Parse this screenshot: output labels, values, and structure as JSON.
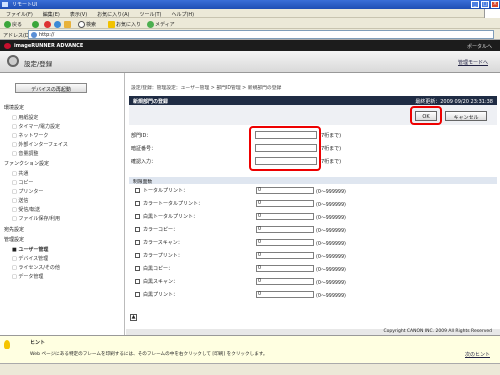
{
  "window": {
    "title": "リモートUI",
    "controls": [
      "_",
      "□",
      "×"
    ]
  },
  "menu": [
    "ファイル(F)",
    "編集(E)",
    "表示(V)",
    "お気に入り(A)",
    "ツール(T)",
    "ヘルプ(H)"
  ],
  "toolbar": {
    "back": "戻る",
    "search": "検索",
    "favorites": "お気に入り",
    "media": "メディア"
  },
  "address": {
    "label": "アドレス(D)",
    "value": "http://"
  },
  "header": {
    "brand": "imageRUNNER ADVANCE",
    "portal": "ポータルへ"
  },
  "page": {
    "title": "設定/登録",
    "link": "管理モードへ"
  },
  "sidebar": {
    "device_button": "デバイスの再起動",
    "groups": [
      {
        "label": "環境設定",
        "items": [
          "用紙設定",
          "タイマー/電力設定",
          "ネットワーク",
          "外部インターフェイス",
          "音量調整"
        ]
      },
      {
        "label": "ファンクション設定",
        "items": [
          "共通",
          "コピー",
          "プリンター",
          "送信",
          "受信/転送",
          "ファイル保存/利用"
        ]
      },
      {
        "label": "宛先設定",
        "items": []
      },
      {
        "label": "管理設定",
        "items": [
          "ユーザー管理",
          "デバイス管理",
          "ライセンス/その他",
          "データ管理"
        ]
      }
    ],
    "active_item": "ユーザー管理"
  },
  "breadcrumb": "設定/登録：管理設定：ユーザー管理 > 部門ID管理 > 新規部門の登録",
  "section": {
    "title": "新規部門の登録",
    "date": "最終更新：2009 09/20 23:31:38"
  },
  "buttons": {
    "ok": "OK",
    "cancel": "キャンセル"
  },
  "fields": [
    {
      "label": "部門ID：",
      "value": "",
      "note": "(7桁まで)"
    },
    {
      "label": "暗証番号：",
      "value": "",
      "note": "(7桁まで)"
    },
    {
      "label": "確認入力：",
      "value": "",
      "note": "(7桁まで)"
    }
  ],
  "limits": {
    "header": "制限面数",
    "rows": [
      {
        "label": "トータルプリント：",
        "value": "0",
        "range": "(0〜999999)"
      },
      {
        "label": "カラートータルプリント：",
        "value": "0",
        "range": "(0〜999999)"
      },
      {
        "label": "白黒トータルプリント：",
        "value": "0",
        "range": "(0〜999999)"
      },
      {
        "label": "カラーコピー：",
        "value": "0",
        "range": "(0〜999999)"
      },
      {
        "label": "カラースキャン：",
        "value": "0",
        "range": "(0〜999999)"
      },
      {
        "label": "カラープリント：",
        "value": "0",
        "range": "(0〜999999)"
      },
      {
        "label": "白黒コピー：",
        "value": "0",
        "range": "(0〜999999)"
      },
      {
        "label": "白黒スキャン：",
        "value": "0",
        "range": "(0〜999999)"
      },
      {
        "label": "白黒プリント：",
        "value": "0",
        "range": "(0〜999999)"
      }
    ]
  },
  "copyright": "Copyright CANON INC. 2009 All Rights Reserved",
  "hint": {
    "title": "ヒント",
    "text": "Web ページにある特定のフレームを印刷するには、そのフレームの中を右クリックして [印刷] をクリックします。",
    "next": "次のヒント"
  },
  "colors": {
    "accent_red": "#e00000",
    "header_bg": "#1c1c1c",
    "section_bar": "#1f2c44"
  }
}
